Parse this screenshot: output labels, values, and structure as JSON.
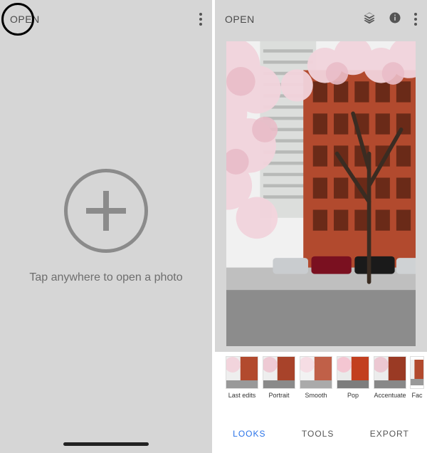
{
  "left": {
    "open_label": "OPEN",
    "empty_hint": "Tap anywhere to open a photo"
  },
  "right": {
    "open_label": "OPEN",
    "looks": [
      {
        "label": "Last edits"
      },
      {
        "label": "Portrait"
      },
      {
        "label": "Smooth"
      },
      {
        "label": "Pop"
      },
      {
        "label": "Accentuate"
      },
      {
        "label": "Fac"
      }
    ],
    "tabs": {
      "looks": "LOOKS",
      "tools": "TOOLS",
      "export": "EXPORT",
      "active": "looks"
    }
  },
  "colors": {
    "accent": "#2a73e8",
    "building": "#b24a2e",
    "highrise": "#e0e2e0",
    "sky": "#f4f4f4",
    "blossom": "#f2d4dc",
    "road": "#8c8c8c",
    "tree": "#3a2c22"
  }
}
